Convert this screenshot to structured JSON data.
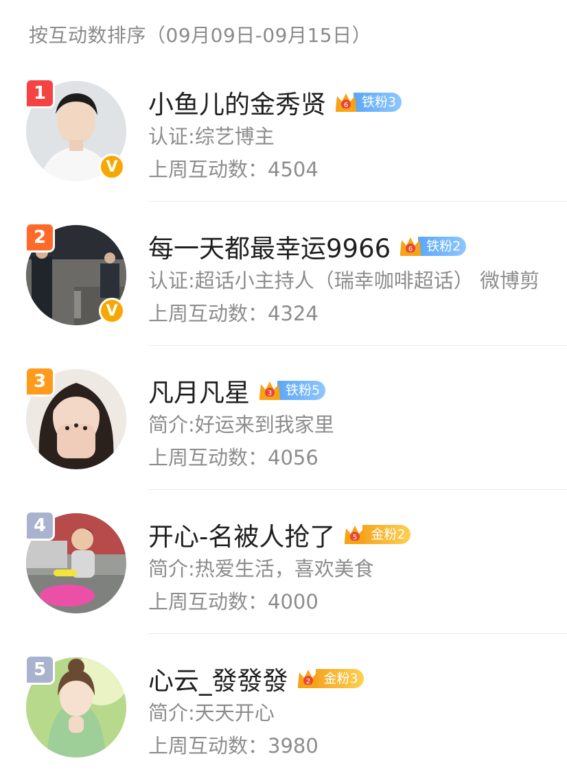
{
  "header": "按互动数排序（09月09日-09月15日）",
  "colors": {
    "rank_1": "#f54343",
    "rank_2": "#ff6a2a",
    "rank_3": "#ff9a1a",
    "rank_other": "#a9b3cf",
    "verified": "#f7a800"
  },
  "users": [
    {
      "rank": "1",
      "name": "小鱼儿的金秀贤",
      "crown_level": "6",
      "fan_label": "铁粉3",
      "fan_type": "iron",
      "verified": true,
      "desc": "认证:综艺博主",
      "stat": "上周互动数：4504"
    },
    {
      "rank": "2",
      "name": "每一天都最幸运9966",
      "crown_level": "6",
      "fan_label": "铁粉2",
      "fan_type": "iron",
      "verified": true,
      "desc": "认证:超话小主持人（瑞幸咖啡超话） 微博剪",
      "stat": "上周互动数：4324"
    },
    {
      "rank": "3",
      "name": "凡月凡星",
      "crown_level": "3",
      "fan_label": "铁粉5",
      "fan_type": "iron",
      "verified": false,
      "desc": "简介:好运来到我家里",
      "stat": "上周互动数：4056"
    },
    {
      "rank": "4",
      "name": "开心-名被人抢了",
      "crown_level": "5",
      "fan_label": "金粉2",
      "fan_type": "gold",
      "verified": false,
      "desc": "简介:热爱生活，喜欢美食",
      "stat": "上周互动数：4000"
    },
    {
      "rank": "5",
      "name": "心云_發發發",
      "crown_level": "2",
      "fan_label": "金粉3",
      "fan_type": "gold",
      "verified": false,
      "desc": "简介:天天开心",
      "stat": "上周互动数：3980"
    }
  ],
  "icons": {
    "crown": "crown-icon",
    "verified": "verified-v-icon"
  }
}
